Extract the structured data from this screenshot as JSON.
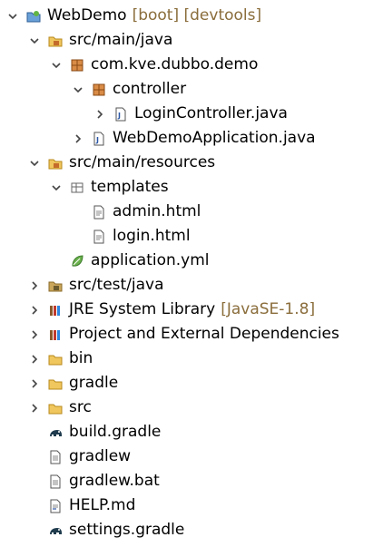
{
  "tree": {
    "project": {
      "label": "WebDemo",
      "decorations": "[boot] [devtools]"
    },
    "src_main_java": {
      "label": "src/main/java"
    },
    "package_demo": {
      "label": "com.kve.dubbo.demo"
    },
    "package_controller": {
      "label": "controller"
    },
    "login_controller": {
      "label": "LoginController.java"
    },
    "webdemo_app": {
      "label": "WebDemoApplication.java"
    },
    "src_main_resources": {
      "label": "src/main/resources"
    },
    "templates": {
      "label": "templates"
    },
    "admin_html": {
      "label": "admin.html"
    },
    "login_html": {
      "label": "login.html"
    },
    "application_yml": {
      "label": "application.yml"
    },
    "src_test_java": {
      "label": "src/test/java"
    },
    "jre_library": {
      "label": "JRE System Library",
      "decorations": "[JavaSE-1.8]"
    },
    "project_deps": {
      "label": "Project and External Dependencies"
    },
    "bin": {
      "label": "bin"
    },
    "gradle": {
      "label": "gradle"
    },
    "src": {
      "label": "src"
    },
    "build_gradle": {
      "label": "build.gradle"
    },
    "gradlew": {
      "label": "gradlew"
    },
    "gradlew_bat": {
      "label": "gradlew.bat"
    },
    "help_md": {
      "label": "HELP.md"
    },
    "settings_gradle": {
      "label": "settings.gradle"
    }
  },
  "colors": {
    "decoration": "#8a6d3b",
    "folder": "#e6b84a",
    "package": "#b5651d",
    "java_file": "#2a55a5"
  }
}
